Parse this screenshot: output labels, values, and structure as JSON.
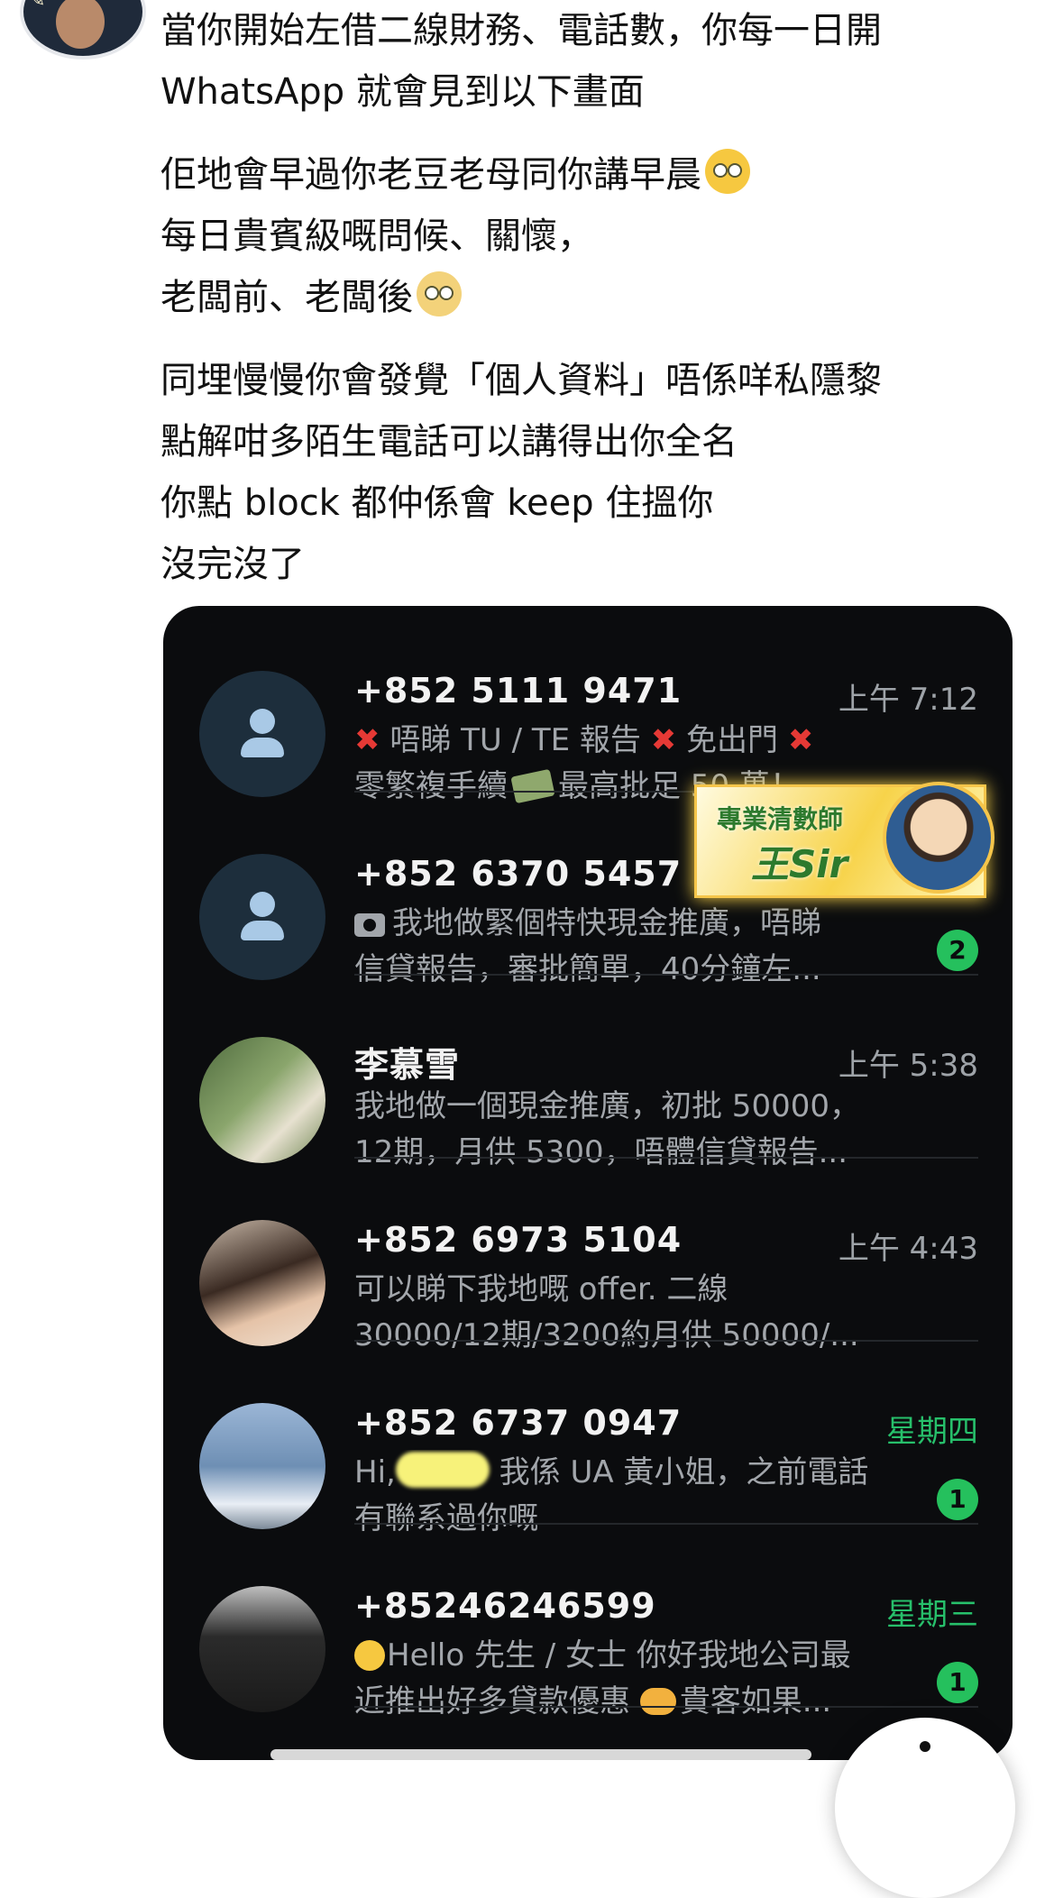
{
  "post": {
    "paragraphs": [
      [
        "當你開始左借二線財務、電話數，你每一日開",
        "WhatsApp 就會見到以下畫面"
      ],
      [
        "佢地會早過你老豆老母同你講早晨",
        "每日貴賓級嘅問候、關懷，",
        "老闆前、老闆後"
      ],
      [
        "同埋慢慢你會發覺「個人資料」唔係咩私隱黎",
        "點解咁多陌生電話可以講得出你全名",
        "你點 block 都仲係會 keep 住搵你",
        "沒完沒了"
      ]
    ]
  },
  "chats": [
    {
      "name": "+852 5111 9471",
      "time": "上午 7:12",
      "preview": [
        "唔睇 TU / TE 報告",
        "免出門",
        "零繁複手續",
        "最高批足 50 萬！..."
      ],
      "unread": ""
    },
    {
      "name": "+852 6370 5457",
      "time": "",
      "preview": [
        "我地做緊個特快現金推廣，唔睇",
        "信貸報告，審批簡單，40分鐘左..."
      ],
      "unread": "2"
    },
    {
      "name": "李慕雪",
      "time": "上午 5:38",
      "preview": [
        "我地做一個現金推廣，初批 50000，",
        "12期，月供 5300，唔體信貸報告..."
      ],
      "unread": ""
    },
    {
      "name": "+852 6973 5104",
      "time": "上午 4:43",
      "preview": [
        "可以睇下我地嘅 offer.  二線",
        "30000/12期/3200約月供 50000/..."
      ],
      "unread": ""
    },
    {
      "name": "+852 6737 0947",
      "time": "星期四",
      "preview": [
        "Hi,",
        "我係 UA 黃小姐，之前電話",
        "有聯系過你嘅"
      ],
      "unread": "1"
    },
    {
      "name": "+85246246599",
      "time": "星期三",
      "preview": [
        "Hello 先生 / 女士 你好我地公司最",
        "近推出好多貸款優惠",
        "貴客如果..."
      ],
      "unread": "1"
    }
  ],
  "watermark": {
    "line1": "專業清數師",
    "line2": "王Sir"
  },
  "icons": {
    "default_avatar": "person-icon",
    "cross": "cross-mark-icon",
    "camera": "camera-icon",
    "money": "money-with-wings-icon",
    "hands": "heart-hands-icon",
    "smile": "smiling-face-icon",
    "laugh": "rolling-laughing-icon",
    "eyeroll": "eye-roll-icon"
  },
  "colors": {
    "chat_bg": "#0b0c0e",
    "unread_badge": "#25c05d",
    "unread_time": "#27c06b",
    "muted_text": "#a2a6ab"
  }
}
